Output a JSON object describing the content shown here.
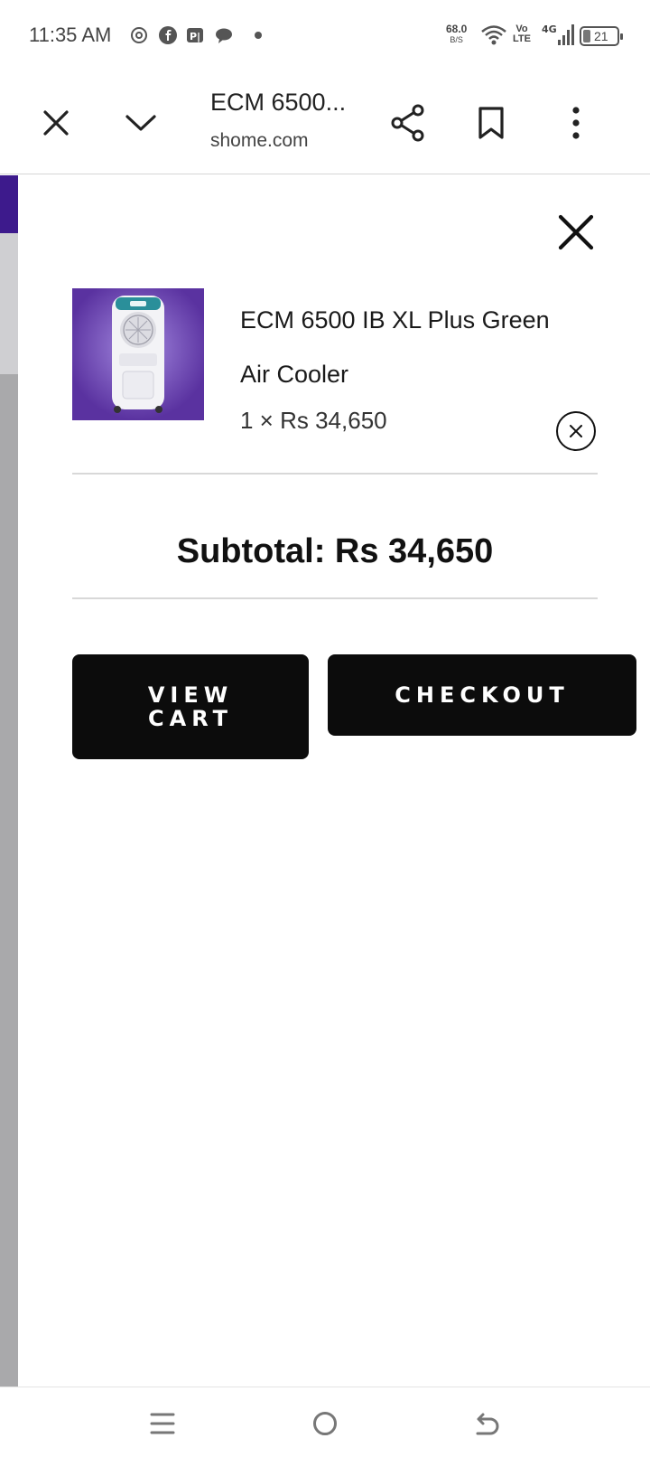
{
  "status_bar": {
    "time": "11:35 AM",
    "net_speed_value": "68.0",
    "net_speed_unit": "B/S",
    "volte_top": "Vo",
    "volte_bottom": "LTE",
    "network": "4G",
    "battery": "21",
    "app_icons": [
      "openai-icon",
      "facebook-icon",
      "paytm-icon",
      "chat-icon"
    ]
  },
  "browser": {
    "title": "ECM 6500...",
    "url": "shome.com",
    "icons": [
      "close-icon",
      "chevron-down-icon",
      "share-icon",
      "bookmark-icon",
      "more-vert-icon"
    ]
  },
  "cart": {
    "item": {
      "name": "ECM 6500 IB XL Plus Green Air Cooler",
      "quantity_price": "1 × Rs 34,650"
    },
    "subtotal": "Subtotal: Rs 34,650",
    "view_cart_label": "VIEW CART",
    "checkout_label": "CHECKOUT"
  },
  "colors": {
    "button_bg": "#0c0c0c",
    "product_bg": "#6a3fb0",
    "divider": "#d8d8d8"
  }
}
